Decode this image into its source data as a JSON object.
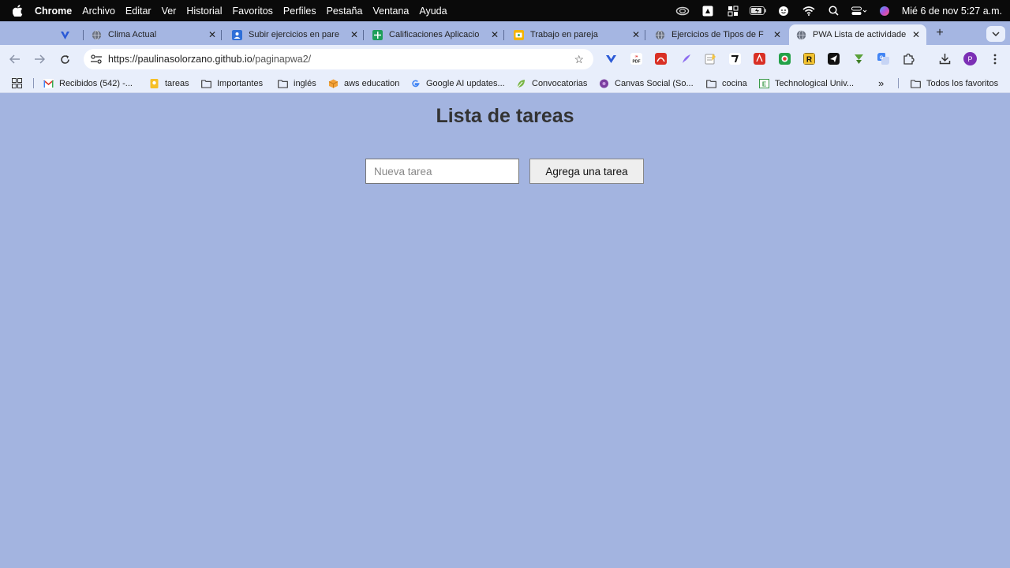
{
  "menubar": {
    "app_name": "Chrome",
    "items": [
      "Archivo",
      "Editar",
      "Ver",
      "Historial",
      "Favoritos",
      "Perfiles",
      "Pestaña",
      "Ventana",
      "Ayuda"
    ],
    "clock": "Mié 6 de nov  5:27 a.m."
  },
  "tabs": [
    {
      "title": "",
      "icon": "vtab-icon",
      "active": false
    },
    {
      "title": "Clima Actual",
      "icon": "globe-icon",
      "active": false
    },
    {
      "title": "Subir ejercicios en pare",
      "icon": "classroom-icon",
      "active": false
    },
    {
      "title": "Calificaciones Aplicacio",
      "icon": "sheets-icon",
      "active": false
    },
    {
      "title": "Trabajo en pareja",
      "icon": "slides-icon",
      "active": false
    },
    {
      "title": "Ejercicios de Tipos de F",
      "icon": "globe-icon",
      "active": false
    },
    {
      "title": "PWA Lista de actividade",
      "icon": "globe-icon",
      "active": true
    }
  ],
  "omnibox": {
    "url_host": "https://paulinasolorzano.github.io",
    "url_path": "/paginapwa2/"
  },
  "profile_initial": "P",
  "bookmarks": [
    {
      "label": "Recibidos (542) -...",
      "icon": "gmail-icon"
    },
    {
      "label": "tareas",
      "icon": "keep-icon"
    },
    {
      "label": "Importantes",
      "icon": "folder-icon"
    },
    {
      "label": "inglés",
      "icon": "folder-icon"
    },
    {
      "label": "aws education",
      "icon": "aws-icon"
    },
    {
      "label": "Google AI updates...",
      "icon": "google-icon"
    },
    {
      "label": "Convocatorias",
      "icon": "leaf-icon"
    },
    {
      "label": "Canvas Social (So...",
      "icon": "canvas-icon"
    },
    {
      "label": "cocina",
      "icon": "folder-icon"
    },
    {
      "label": "Technological Univ...",
      "icon": "univ-icon"
    }
  ],
  "bookmarks_overflow": "»",
  "bookmarks_all": "Todos los favoritos",
  "page": {
    "title": "Lista de tareas",
    "input_placeholder": "Nueva tarea",
    "input_value": "",
    "add_button_label": "Agrega una tarea"
  }
}
